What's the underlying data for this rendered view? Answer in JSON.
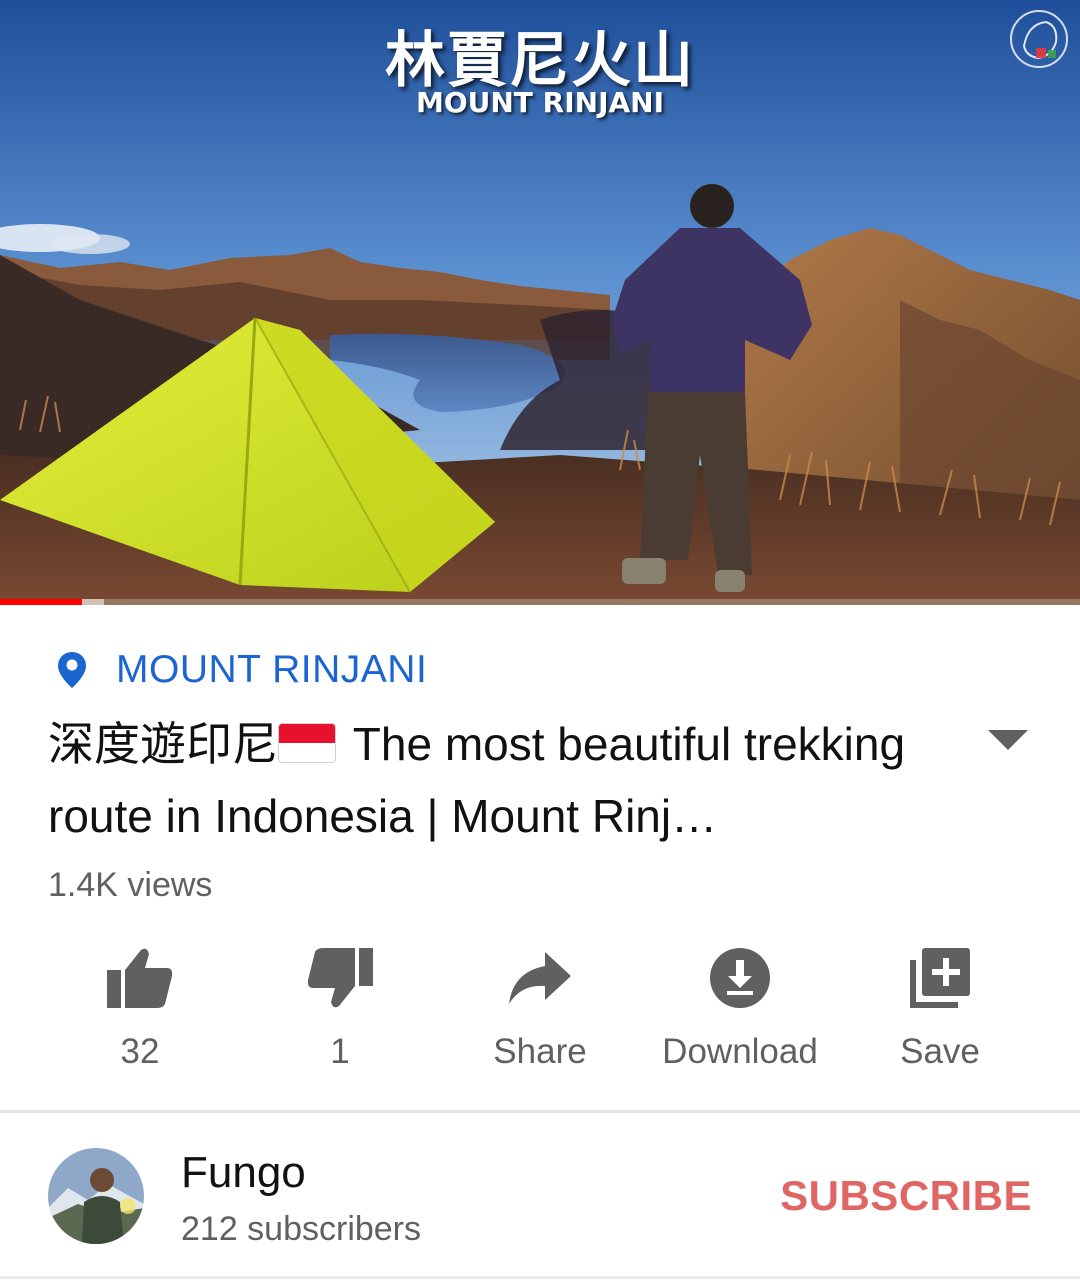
{
  "video": {
    "overlay_title": "林賈尼火山",
    "overlay_subtitle": "MOUNT RINJANI",
    "progress_played_fraction": 0.076
  },
  "location": {
    "label": "MOUNT RINJANI",
    "icon": "location-pin-icon"
  },
  "title": {
    "prefix": "深度遊印尼",
    "text": "The most beautiful trekking route in Indonesia | Mount Rinj…",
    "flag": "indonesia-flag"
  },
  "views": "1.4K views",
  "actions": {
    "like": {
      "label": "32",
      "icon": "thumbs-up-icon"
    },
    "dislike": {
      "label": "1",
      "icon": "thumbs-down-icon"
    },
    "share": {
      "label": "Share",
      "icon": "share-icon"
    },
    "download": {
      "label": "Download",
      "icon": "download-icon"
    },
    "save": {
      "label": "Save",
      "icon": "playlist-add-icon"
    }
  },
  "channel": {
    "name": "Fungo",
    "subscribers": "212 subscribers",
    "subscribe_label": "SUBSCRIBE"
  },
  "colors": {
    "location_blue": "#1a65d0",
    "subscribe_red": "#e06666",
    "progress_red": "#ff0000",
    "icon_gray": "#606060"
  }
}
